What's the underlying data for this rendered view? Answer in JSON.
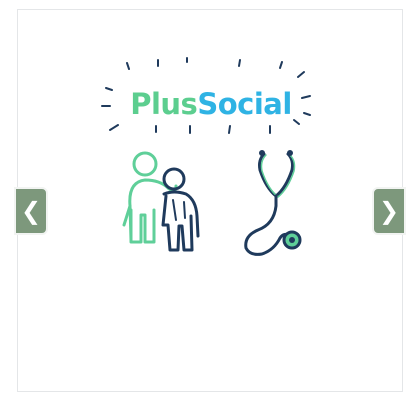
{
  "logo": {
    "part1": "Plus",
    "part2": "Social",
    "color_part1": "#5cce8f",
    "color_part2": "#2fb3e4"
  },
  "illustration": {
    "people_icon": "two-people-icon",
    "stethoscope_icon": "stethoscope-icon",
    "accent_color": "#5fcf99",
    "ink_color": "#1f3a5c"
  },
  "carousel": {
    "prev_label": "❮",
    "next_label": "❯",
    "arrow_color": "#7d987c"
  }
}
